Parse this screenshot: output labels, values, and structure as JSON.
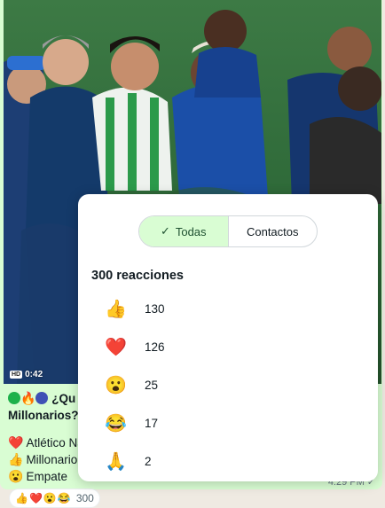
{
  "video": {
    "hd_label": "HD",
    "duration": "0:42"
  },
  "caption": {
    "title_line1": "¿Qu",
    "title_line2": "Millonarios?",
    "title_dots": [
      "#1db14a",
      "🔥",
      "#3f51b5"
    ],
    "options": [
      {
        "emoji": "❤️",
        "text": "Atlético Na"
      },
      {
        "emoji": "👍",
        "text": "Millonario"
      },
      {
        "emoji": "😮",
        "text": "Empate"
      }
    ]
  },
  "message": {
    "time": "4:29 PM",
    "status_icon": "check-icon"
  },
  "reactions_pill": {
    "emojis": [
      "👍",
      "❤️",
      "😮",
      "😂",
      "🙏"
    ],
    "count": "300"
  },
  "popup": {
    "tabs": [
      {
        "label": "Todas",
        "active": true,
        "icon": "check-icon"
      },
      {
        "label": "Contactos",
        "active": false
      }
    ],
    "heading": "300 reacciones",
    "reactions": [
      {
        "emoji": "👍",
        "count": "130"
      },
      {
        "emoji": "❤️",
        "count": "126"
      },
      {
        "emoji": "😮",
        "count": "25"
      },
      {
        "emoji": "😂",
        "count": "17"
      },
      {
        "emoji": "🙏",
        "count": "2"
      }
    ]
  },
  "colors": {
    "bubble": "#d9fdd3",
    "active_tab": "#d9fdd3",
    "chat_bg": "#efeae2"
  }
}
